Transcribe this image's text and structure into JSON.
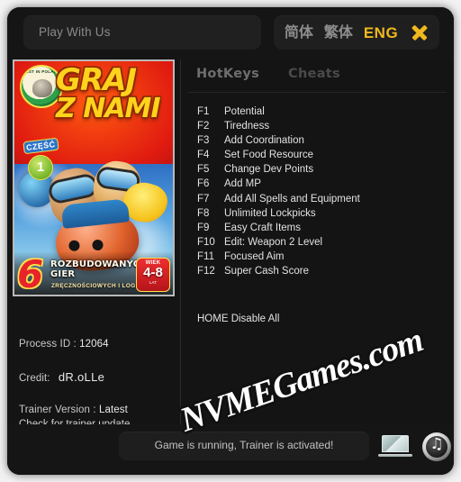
{
  "window": {
    "search": {
      "placeholder": "Play With Us"
    },
    "languages": [
      {
        "id": "simplified-chinese",
        "label": "简体",
        "active": false
      },
      {
        "id": "traditional-chinese",
        "label": "繁体",
        "active": false
      },
      {
        "id": "english",
        "label": "ENG",
        "active": true
      }
    ],
    "close_icon": "close-icon",
    "accent_color": "#f0b81e"
  },
  "cover": {
    "publisher_badge": "BEST IN POLAND",
    "part_label": "CZĘŚĆ",
    "part_number": "1",
    "title_line1": "GRAJ",
    "title_line2": "Z NAMI",
    "games_count": "6",
    "subtitle_main": "ROZBUDOWANYCH GIER",
    "subtitle_sub": "ZRĘCZNOŚCIOWYCH I LOGICZNYCH",
    "age_label": "WIEK",
    "age_range": "4-8",
    "age_suffix": "LAT"
  },
  "info": {
    "process_label": "Process ID :",
    "process_value": "12064",
    "credit_label": "Credit:",
    "credit_value": "dR.oLLe",
    "version_label": "Trainer Version :",
    "version_value": "Latest",
    "update_link": "Check for trainer update"
  },
  "tabs": [
    {
      "id": "hotkeys",
      "label": "HotKeys",
      "active": true
    },
    {
      "id": "cheats",
      "label": "Cheats",
      "active": false
    }
  ],
  "cheats": [
    {
      "key": "F1",
      "desc": "Potential"
    },
    {
      "key": "F2",
      "desc": "Tiredness"
    },
    {
      "key": "F3",
      "desc": "Add Coordination"
    },
    {
      "key": "F4",
      "desc": "Set Food Resource"
    },
    {
      "key": "F5",
      "desc": "Change Dev Points"
    },
    {
      "key": "F6",
      "desc": "Add MP"
    },
    {
      "key": "F7",
      "desc": "Add All Spells and Equipment"
    },
    {
      "key": "F8",
      "desc": "Unlimited Lockpicks"
    },
    {
      "key": "F9",
      "desc": "Easy Craft Items"
    },
    {
      "key": "F10",
      "desc": "Edit: Weapon 2 Level"
    },
    {
      "key": "F11",
      "desc": "Focused Aim"
    },
    {
      "key": "F12",
      "desc": "Super Cash Score"
    }
  ],
  "disable_all": "HOME Disable All",
  "status": {
    "message": "Game is running, Trainer is activated!"
  },
  "bottom_icons": [
    {
      "id": "laptop-icon",
      "name": "laptop-icon"
    },
    {
      "id": "music-icon",
      "name": "music-note-icon",
      "glyph": "♫"
    }
  ],
  "watermark": {
    "text": "NVMEGames.com"
  }
}
